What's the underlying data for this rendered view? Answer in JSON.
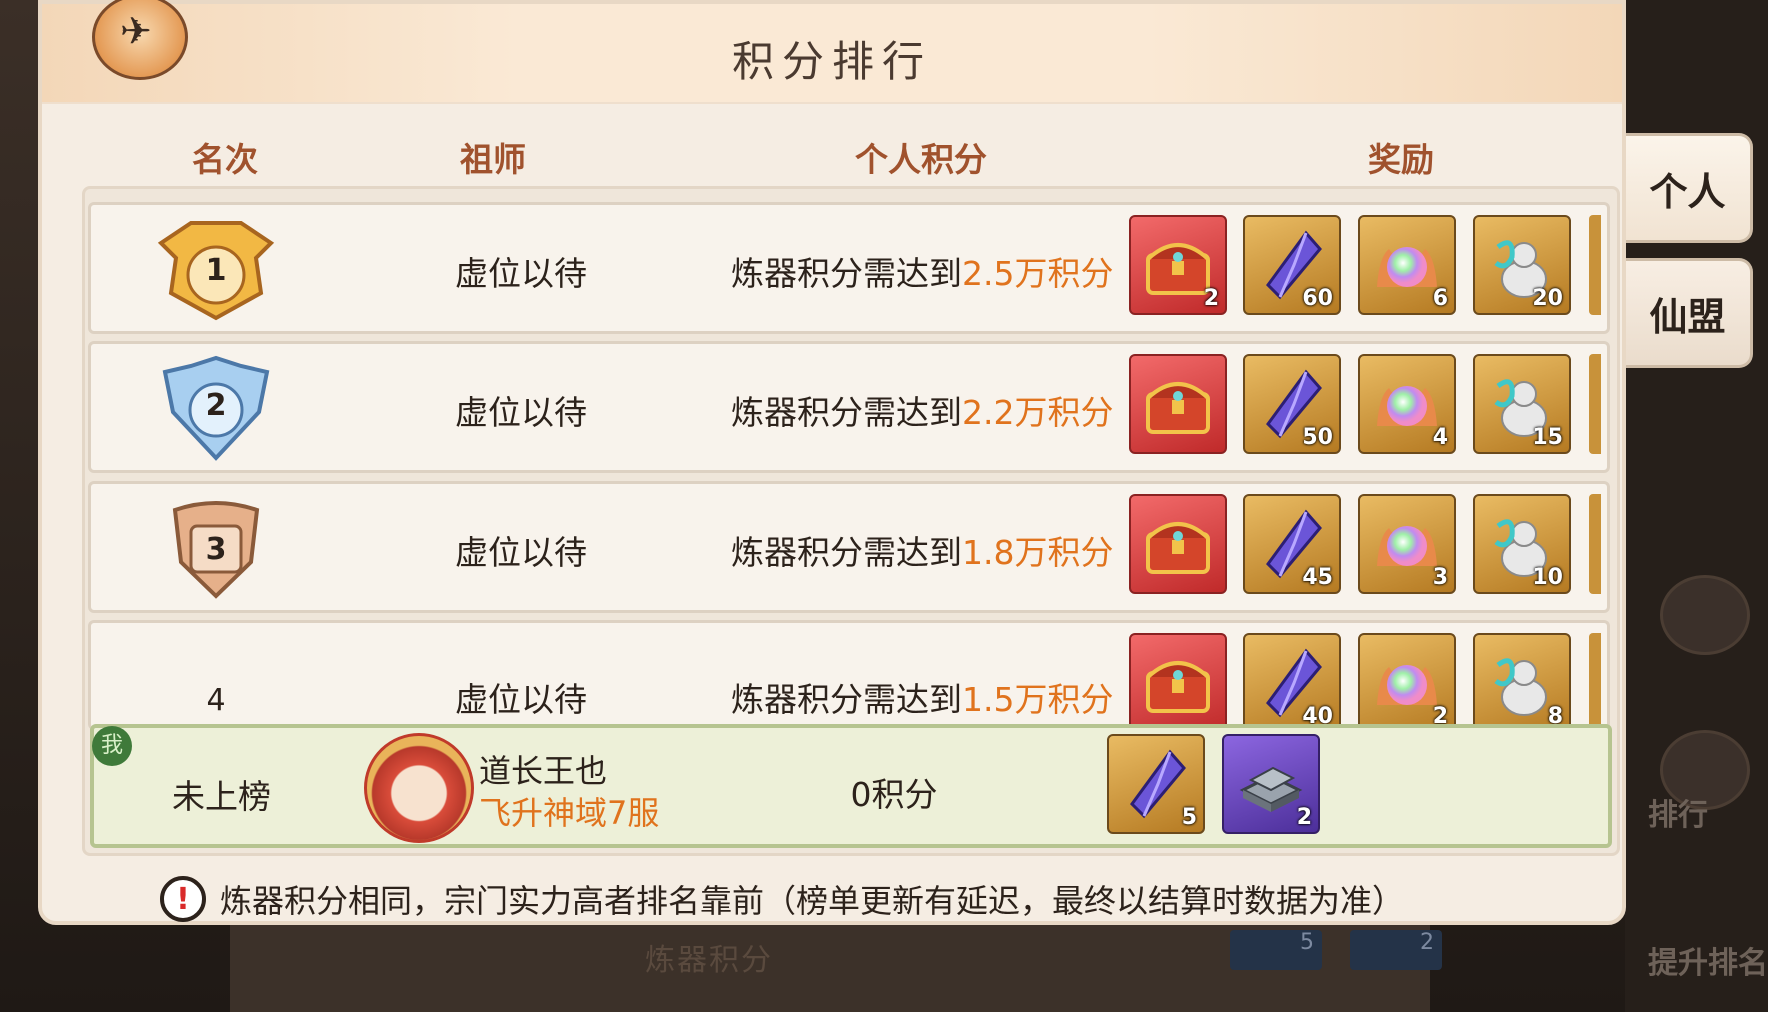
{
  "panel": {
    "title": "积分排行"
  },
  "columns": {
    "rank": "名次",
    "master": "祖师",
    "score": "个人积分",
    "reward": "奖励"
  },
  "side_tabs": [
    {
      "label": "个人",
      "active": true
    },
    {
      "label": "仙盟",
      "active": false
    }
  ],
  "side_ghost": {
    "rank_label": "排行",
    "boost_label": "提升排名"
  },
  "rows": [
    {
      "rank": "1",
      "badge": "gold",
      "name": "虚位以待",
      "req_prefix": "炼器积分需达到",
      "req_value": "2.5万积分",
      "rewards": [
        {
          "icon": "treasure-chest-icon",
          "count": "2",
          "bg": "red"
        },
        {
          "icon": "purple-crystal-icon",
          "count": "60",
          "bg": "gold"
        },
        {
          "icon": "rainbow-pearl-icon",
          "count": "6",
          "bg": "gold"
        },
        {
          "icon": "jade-gourd-icon",
          "count": "20",
          "bg": "gold"
        }
      ]
    },
    {
      "rank": "2",
      "badge": "silver",
      "name": "虚位以待",
      "req_prefix": "炼器积分需达到",
      "req_value": "2.2万积分",
      "rewards": [
        {
          "icon": "treasure-chest-icon",
          "count": "",
          "bg": "red"
        },
        {
          "icon": "purple-crystal-icon",
          "count": "50",
          "bg": "gold"
        },
        {
          "icon": "rainbow-pearl-icon",
          "count": "4",
          "bg": "gold"
        },
        {
          "icon": "jade-gourd-icon",
          "count": "15",
          "bg": "gold"
        }
      ]
    },
    {
      "rank": "3",
      "badge": "bronze",
      "name": "虚位以待",
      "req_prefix": "炼器积分需达到",
      "req_value": "1.8万积分",
      "rewards": [
        {
          "icon": "treasure-chest-icon",
          "count": "",
          "bg": "red"
        },
        {
          "icon": "purple-crystal-icon",
          "count": "45",
          "bg": "gold"
        },
        {
          "icon": "rainbow-pearl-icon",
          "count": "3",
          "bg": "gold"
        },
        {
          "icon": "jade-gourd-icon",
          "count": "10",
          "bg": "gold"
        }
      ]
    },
    {
      "rank": "4",
      "badge": "none",
      "name": "虚位以待",
      "req_prefix": "炼器积分需达到",
      "req_value": "1.5万积分",
      "rewards": [
        {
          "icon": "treasure-chest-icon",
          "count": "",
          "bg": "red"
        },
        {
          "icon": "purple-crystal-icon",
          "count": "40",
          "bg": "gold"
        },
        {
          "icon": "rainbow-pearl-icon",
          "count": "2",
          "bg": "gold"
        },
        {
          "icon": "jade-gourd-icon",
          "count": "8",
          "bg": "gold"
        }
      ]
    }
  ],
  "me": {
    "tag": "我",
    "rank": "未上榜",
    "name": "道长王也",
    "server": "飞升神域7服",
    "score": "0积分",
    "rewards": [
      {
        "icon": "purple-crystal-icon",
        "count": "5",
        "bg": "gold"
      },
      {
        "icon": "iron-ingot-icon",
        "count": "2",
        "bg": "purple"
      }
    ]
  },
  "footer": {
    "note": "炼器积分相同，宗门实力高者排名靠前（榜单更新有延迟，最终以结算时数据为准）"
  },
  "background": {
    "faded_text": "炼器积分",
    "faded_counts": [
      "5",
      "2"
    ]
  },
  "colors": {
    "accent_orange": "#e0731d",
    "header_brown": "#a0522d",
    "panel_bg": "#f5ede3",
    "my_row_bg": "#edf0d8"
  }
}
